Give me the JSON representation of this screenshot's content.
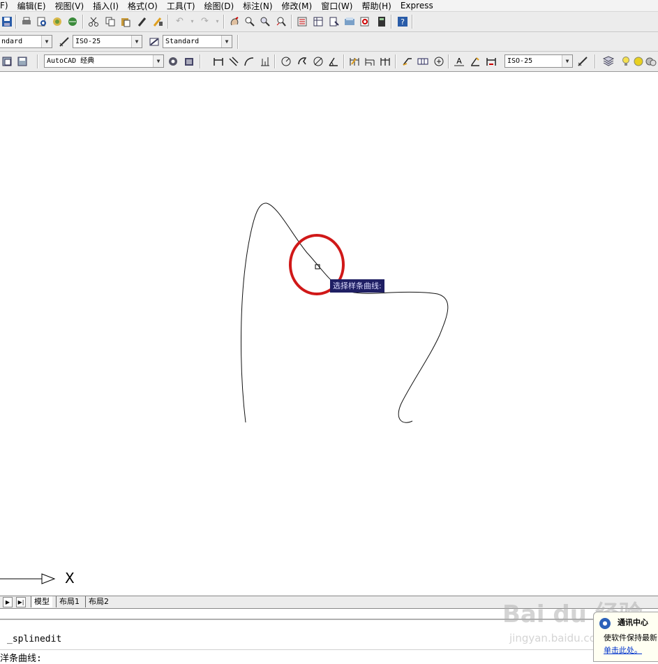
{
  "menu": {
    "items": [
      "F)",
      "编辑(E)",
      "视图(V)",
      "插入(I)",
      "格式(O)",
      "工具(T)",
      "绘图(D)",
      "标注(N)",
      "修改(M)",
      "窗口(W)",
      "帮助(H)",
      "Express"
    ]
  },
  "styles_toolbar": {
    "text_style_value": "ndard",
    "dim_style_value": "ISO-25",
    "table_style_value": "Standard"
  },
  "workspace_toolbar": {
    "workspace_value": "AutoCAD 经典",
    "dim_style_value": "ISO-25"
  },
  "drawing": {
    "tooltip": "选择样条曲线:",
    "highlight_color": "#d01818",
    "ucs_axis_label": "X"
  },
  "layout_tabs": [
    "模型",
    "布局1",
    "布局2"
  ],
  "command": {
    "line1": "_splinedit",
    "line2": "洋条曲线:"
  },
  "comm_center": {
    "title": "通讯中心",
    "line2": "使软件保持最新",
    "link": "单击此处。"
  },
  "watermark": {
    "brand": "Bai du 经验",
    "url": "jingyan.baidu.com"
  }
}
